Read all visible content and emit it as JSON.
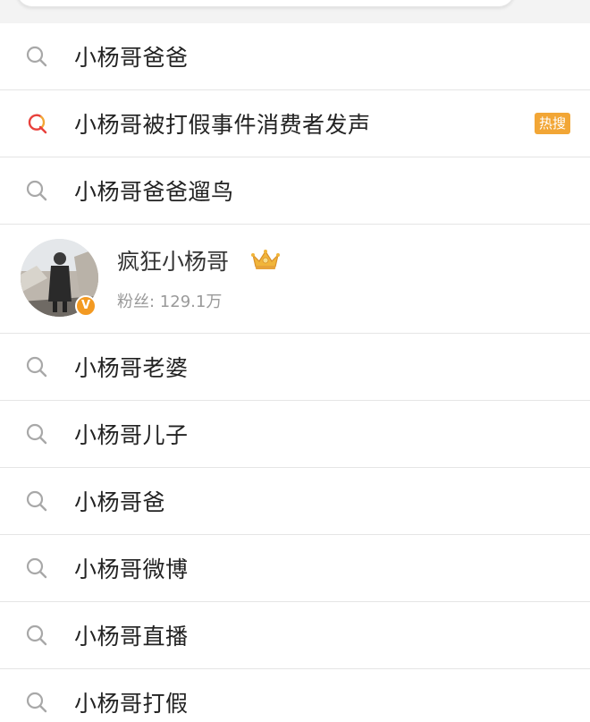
{
  "suggestions_top": [
    {
      "label": "小杨哥爸爸",
      "icon": "search-icon"
    },
    {
      "label": "小杨哥被打假事件消费者发声",
      "icon": "hot-search-icon",
      "badge": "热搜"
    },
    {
      "label": "小杨哥爸爸遛鸟",
      "icon": "search-icon"
    }
  ],
  "user": {
    "name": "疯狂小杨哥",
    "fans": "粉丝: 129.1万",
    "verified_mark": "V",
    "avatar": "avatar-photo"
  },
  "suggestions_bottom": [
    {
      "label": "小杨哥老婆",
      "icon": "search-icon"
    },
    {
      "label": "小杨哥儿子",
      "icon": "search-icon"
    },
    {
      "label": "小杨哥爸",
      "icon": "search-icon"
    },
    {
      "label": "小杨哥微博",
      "icon": "search-icon"
    },
    {
      "label": "小杨哥直播",
      "icon": "search-icon"
    },
    {
      "label": "小杨哥打假",
      "icon": "search-icon"
    }
  ],
  "colors": {
    "hot_badge": "#f2a636",
    "verified": "#f39a22",
    "text": "#222222",
    "secondary_text": "#9a9a9a",
    "divider": "#e5e5e5"
  }
}
